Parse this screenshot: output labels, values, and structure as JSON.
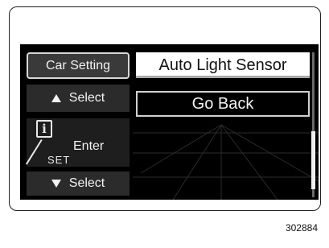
{
  "sidebar": {
    "category_label": "Car Setting",
    "select_up_label": "Select",
    "enter_icon_glyph": "i",
    "enter_set_label": "SET",
    "enter_label": "Enter",
    "select_down_label": "Select"
  },
  "menu": {
    "items": [
      {
        "label": "Auto Light Sensor",
        "selected": true
      },
      {
        "label": "Go Back",
        "selected": false
      }
    ]
  },
  "footer": {
    "image_code": "302884"
  },
  "icons": {
    "select_up": "triangle-up-icon",
    "select_down": "triangle-down-icon",
    "enter": "info-set-icon"
  }
}
